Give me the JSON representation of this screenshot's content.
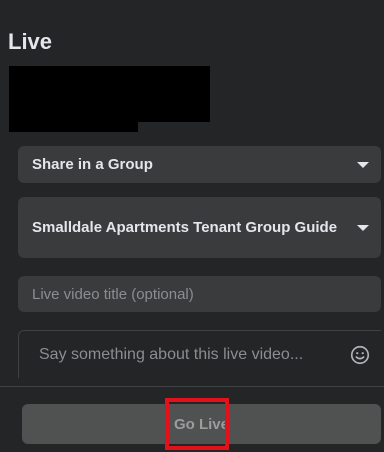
{
  "header": {
    "title": "Live"
  },
  "share_select": {
    "value": "Share in a Group"
  },
  "group_select": {
    "value": "Smalldale Apartments Tenant Group Guide"
  },
  "title_input": {
    "placeholder": "Live video title (optional)",
    "value": ""
  },
  "description_input": {
    "placeholder": "Say something about this live video...",
    "value": ""
  },
  "footer": {
    "go_live_label": "Go Live"
  },
  "icons": {
    "dropdown": "chevron-down-icon",
    "emoji": "smiley-icon"
  },
  "colors": {
    "panel": "#242526",
    "field": "#3a3b3c",
    "button_disabled": "#505151",
    "highlight": "#e4111b"
  }
}
